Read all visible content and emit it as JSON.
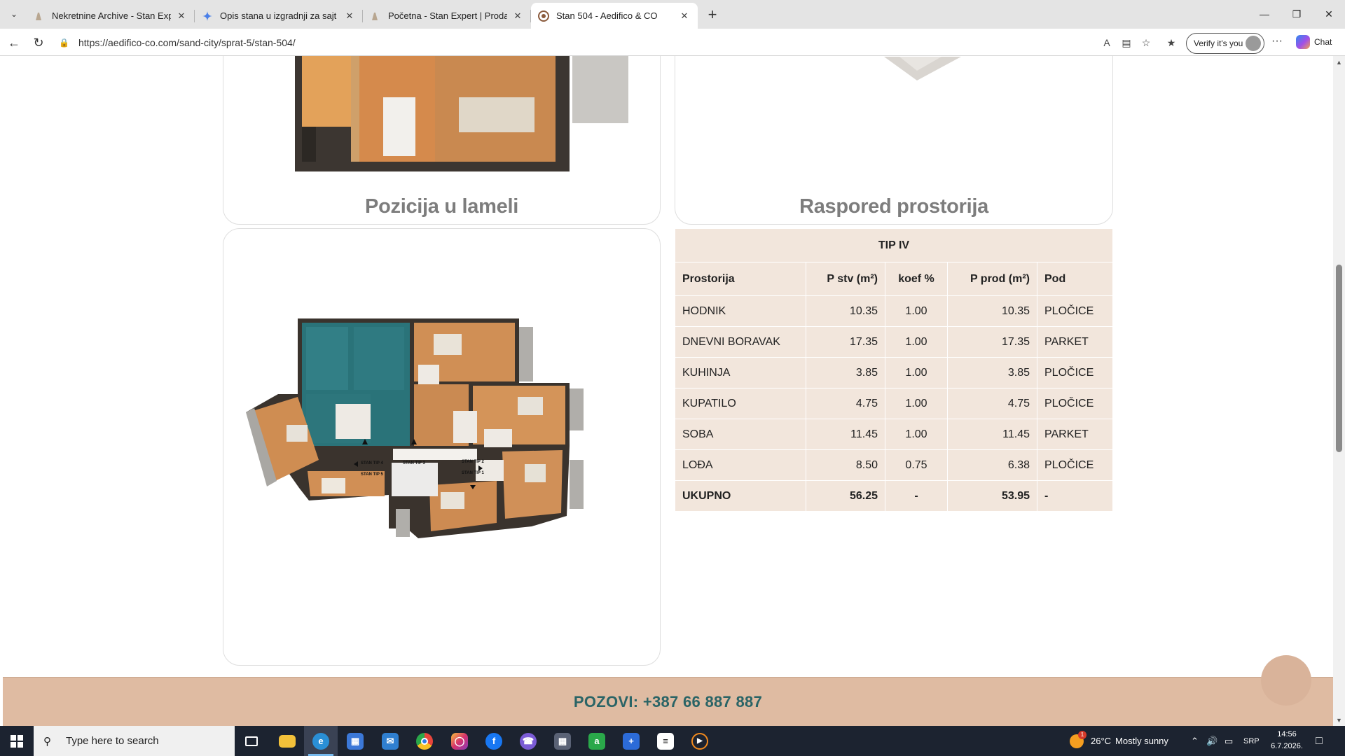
{
  "browser": {
    "tabs": [
      {
        "title": "Nekretnine Archive - Stan Expert |",
        "favicon": "building-icon",
        "active": false
      },
      {
        "title": "Opis stana u izgradnji za sajt - Goo",
        "favicon": "gemini-icon",
        "active": false
      },
      {
        "title": "Početna - Stan Expert | Prodaja i iz",
        "favicon": "building-icon",
        "active": false
      },
      {
        "title": "Stan 504 - Aedifico & CO",
        "favicon": "aedifico-icon",
        "active": true
      }
    ],
    "url": "https://aedifico-co.com/sand-city/sprat-5/stan-504/",
    "verify_label": "Verify it's you",
    "chat_label": "Chat"
  },
  "page": {
    "position_title": "Pozicija u lameli",
    "rooms_title": "Raspored prostorija",
    "plan_labels": [
      "STAN TIP 4",
      "STAN TIP 3",
      "STAN TIP 2",
      "STAN TIP 5",
      "STAN TIP 1"
    ],
    "table": {
      "type_label": "TIP IV",
      "headers": [
        "Prostorija",
        "P stv (m²)",
        "koef %",
        "P prod (m²)",
        "Pod"
      ],
      "rows": [
        [
          "HODNIK",
          "10.35",
          "1.00",
          "10.35",
          "PLOČICE"
        ],
        [
          "DNEVNI BORAVAK",
          "17.35",
          "1.00",
          "17.35",
          "PARKET"
        ],
        [
          "KUHINJA",
          "3.85",
          "1.00",
          "3.85",
          "PLOČICE"
        ],
        [
          "KUPATILO",
          "4.75",
          "1.00",
          "4.75",
          "PLOČICE"
        ],
        [
          "SOBA",
          "11.45",
          "1.00",
          "11.45",
          "PARKET"
        ],
        [
          "LOĐA",
          "8.50",
          "0.75",
          "6.38",
          "PLOČICE"
        ]
      ],
      "total": [
        "UKUPNO",
        "56.25",
        "-",
        "53.95",
        "-"
      ]
    },
    "call_text": "POZOVI: +387 66 887 887"
  },
  "taskbar": {
    "search_placeholder": "Type here to search",
    "apps": [
      {
        "name": "task-view-icon",
        "color": "#1c2330"
      },
      {
        "name": "file-explorer-icon",
        "color": "#f3c13a"
      },
      {
        "name": "edge-icon",
        "color": "#2a8fd6"
      },
      {
        "name": "microsoft-store-icon",
        "color": "#3b78d8"
      },
      {
        "name": "mail-icon",
        "color": "#2f7fd0"
      },
      {
        "name": "chrome-icon",
        "color": "#e8453c"
      },
      {
        "name": "instagram-icon",
        "color": "#d6336c"
      },
      {
        "name": "facebook-icon",
        "color": "#1877f2"
      },
      {
        "name": "viber-icon",
        "color": "#7b5cd6"
      },
      {
        "name": "calculator-icon",
        "color": "#5a6275"
      },
      {
        "name": "autenti-icon",
        "color": "#2aa84a"
      },
      {
        "name": "plus-app-icon",
        "color": "#2c6bd8"
      },
      {
        "name": "capcut-icon",
        "color": "#ffffff"
      },
      {
        "name": "media-player-icon",
        "color": "#f28a1e"
      }
    ],
    "weather_temp": "26°C",
    "weather_text": "Mostly sunny",
    "weather_badge": "1",
    "language": "SRP",
    "time": "14:56",
    "date": "6.7.2026."
  }
}
